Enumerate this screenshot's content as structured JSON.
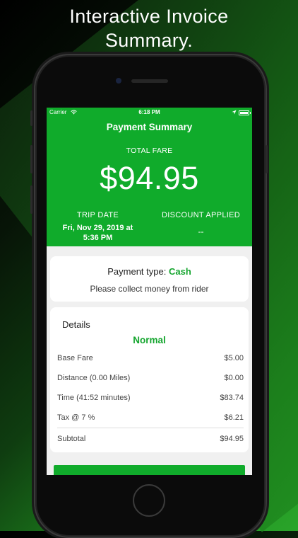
{
  "promo": {
    "line1": "Interactive Invoice",
    "line2": "Summary."
  },
  "status_bar": {
    "carrier": "Carrier",
    "time": "6:18 PM",
    "icons": [
      "wifi-icon",
      "location-arrow-icon",
      "battery-icon"
    ]
  },
  "header": {
    "title": "Payment Summary",
    "total_fare_label": "TOTAL FARE",
    "total_fare": "$94.95",
    "trip_date_label": "TRIP DATE",
    "trip_date_line1": "Fri, Nov 29, 2019 at",
    "trip_date_line2": "5:36 PM",
    "discount_label": "DISCOUNT APPLIED",
    "discount_value": "--"
  },
  "payment": {
    "type_label": "Payment type:",
    "type_value": "Cash",
    "note": "Please collect money from rider"
  },
  "details": {
    "heading": "Details",
    "mode": "Normal",
    "rows": [
      {
        "label": "Base Fare",
        "value": "$5.00"
      },
      {
        "label": "Distance (0.00 Miles)",
        "value": "$0.00"
      },
      {
        "label": "Time (41:52 minutes)",
        "value": "$83.74"
      },
      {
        "label": "Tax @ 7 %",
        "value": "$6.21"
      },
      {
        "label": "Subtotal",
        "value": "$94.95"
      }
    ]
  },
  "colors": {
    "brand_green": "#10ab2b",
    "accent_green_text": "#14a52e",
    "card_bg": "#ffffff",
    "screen_bg": "#f0f0f0"
  }
}
